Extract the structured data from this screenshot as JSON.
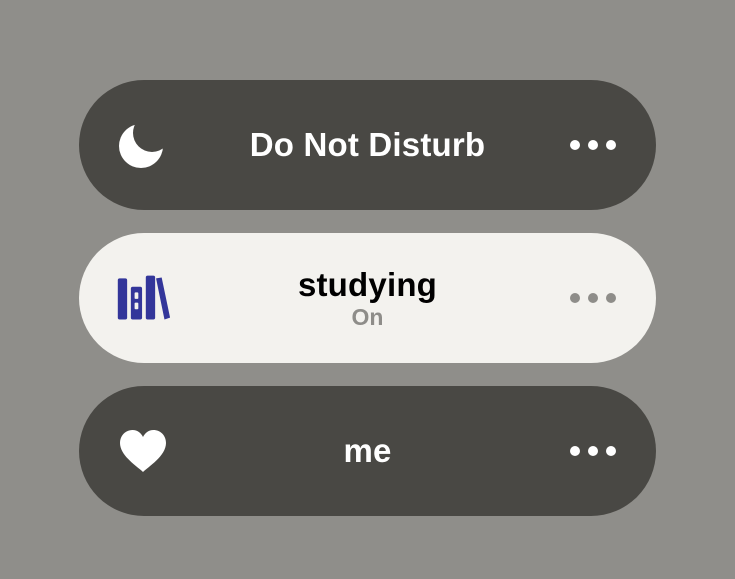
{
  "focus_modes": [
    {
      "title": "Do Not Disturb",
      "status": "",
      "icon": "moon-icon",
      "more_icon": "more-icon"
    },
    {
      "title": "studying",
      "status": "On",
      "icon": "books-icon",
      "icon_color": "#33369a",
      "more_icon": "more-icon"
    },
    {
      "title": "me",
      "status": "",
      "icon": "heart-icon",
      "more_icon": "more-icon"
    }
  ],
  "colors": {
    "background": "#8f8e8a",
    "pill_inactive": "#494844",
    "pill_active": "#f3f2ee",
    "status_text": "#8e8d89"
  }
}
